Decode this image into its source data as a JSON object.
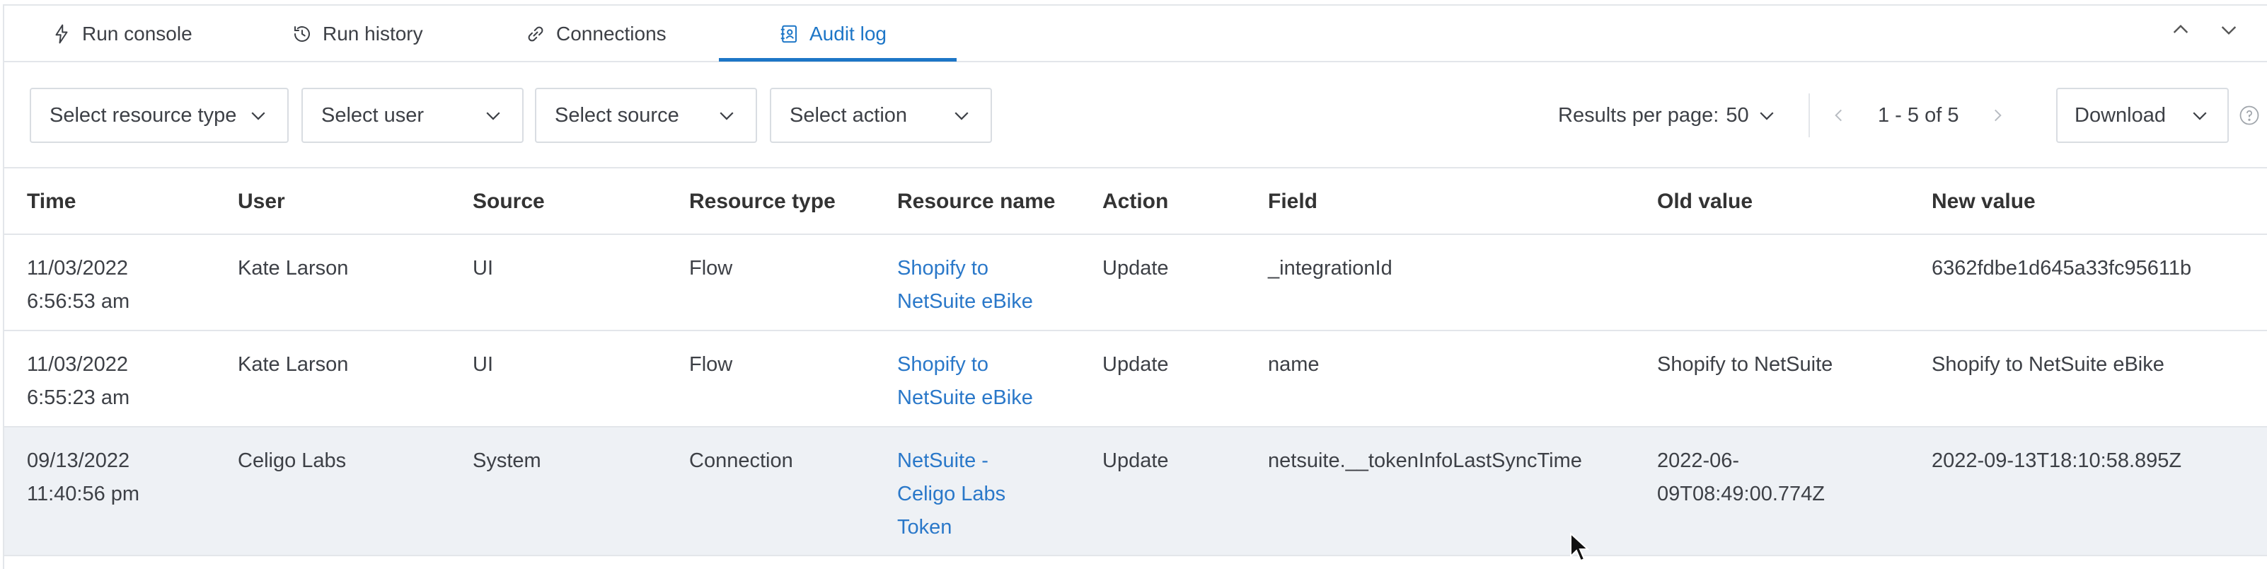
{
  "tabs": [
    {
      "label": "Run console",
      "icon": "bolt-icon"
    },
    {
      "label": "Run history",
      "icon": "history-icon"
    },
    {
      "label": "Connections",
      "icon": "link-icon"
    },
    {
      "label": "Audit log",
      "icon": "audit-icon",
      "active": true
    }
  ],
  "filters": {
    "resource_type": "Select resource type",
    "user": "Select user",
    "source": "Select source",
    "action": "Select action"
  },
  "pagination": {
    "results_per_page_label": "Results per page:",
    "results_per_page_value": "50",
    "range": "1 - 5 of 5"
  },
  "download_label": "Download",
  "colors": {
    "accent": "#1d76c7",
    "link": "#2a78c9",
    "row_highlight": "#eef1f5"
  },
  "table": {
    "columns": [
      "Time",
      "User",
      "Source",
      "Resource type",
      "Resource name",
      "Action",
      "Field",
      "Old value",
      "New value"
    ],
    "rows": [
      {
        "time_date": "11/03/2022",
        "time_clock": "6:56:53 am",
        "user": "Kate Larson",
        "source": "UI",
        "resource_type": "Flow",
        "resource_name_1": "Shopify to",
        "resource_name_2": "NetSuite eBike",
        "resource_name_3": "",
        "action": "Update",
        "field": "_integrationId",
        "old_value_1": "",
        "old_value_2": "",
        "new_value": "6362fdbe1d645a33fc95611b"
      },
      {
        "time_date": "11/03/2022",
        "time_clock": "6:55:23 am",
        "user": "Kate Larson",
        "source": "UI",
        "resource_type": "Flow",
        "resource_name_1": "Shopify to",
        "resource_name_2": "NetSuite eBike",
        "resource_name_3": "",
        "action": "Update",
        "field": "name",
        "old_value_1": "Shopify to NetSuite",
        "old_value_2": "",
        "new_value": "Shopify to NetSuite eBike"
      },
      {
        "time_date": "09/13/2022",
        "time_clock": "11:40:56 pm",
        "user": "Celigo Labs",
        "source": "System",
        "resource_type": "Connection",
        "resource_name_1": "NetSuite -",
        "resource_name_2": "Celigo Labs",
        "resource_name_3": "Token",
        "action": "Update",
        "field": "netsuite.__tokenInfoLastSyncTime",
        "old_value_1": "2022-06-",
        "old_value_2": "09T08:49:00.774Z",
        "new_value": "2022-09-13T18:10:58.895Z"
      }
    ]
  }
}
